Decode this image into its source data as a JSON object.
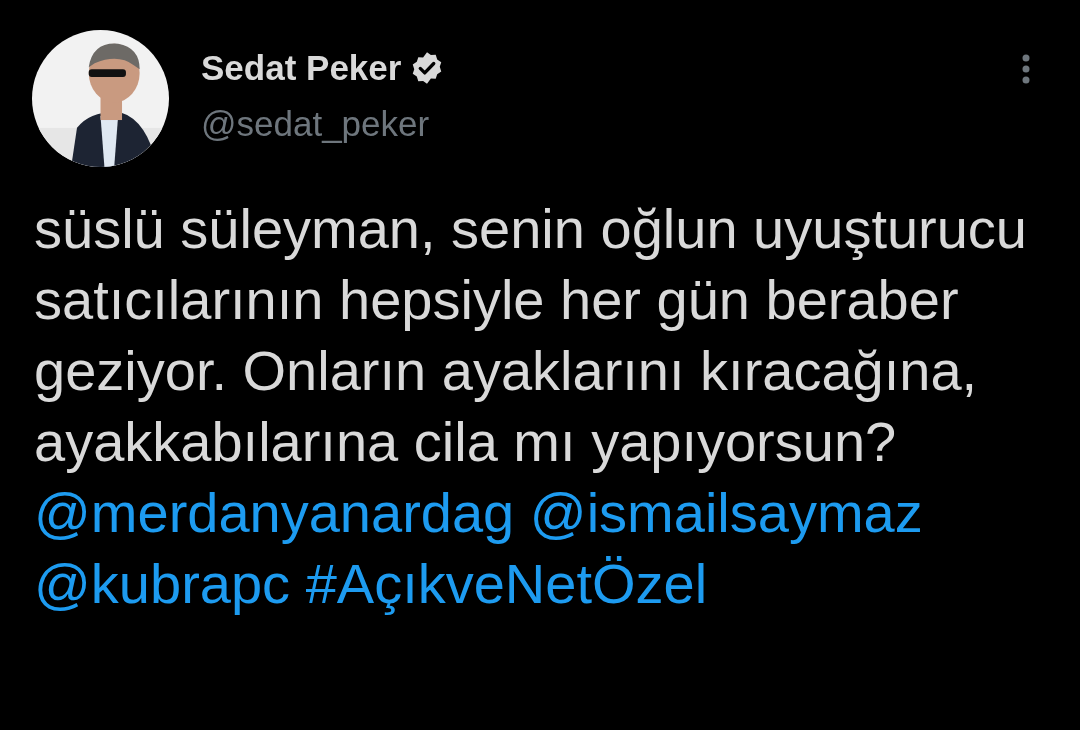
{
  "author": {
    "name": "Sedat Peker",
    "verified": true,
    "handle": "@sedat_peker"
  },
  "tweet": {
    "segments": [
      {
        "kind": "text",
        "text": "süslü süleyman, senin oğlun uyuşturucu satıcılarının hepsiyle her gün beraber geziyor. Onların ayaklarını kıracağına, ayakkabılarına cila mı yapıyorsun?"
      },
      {
        "kind": "mention",
        "text": "@merdanyanardag"
      },
      {
        "kind": "mention",
        "text": "@ismailsaymaz"
      },
      {
        "kind": "mention",
        "text": "@kubrapc"
      },
      {
        "kind": "hashtag",
        "text": "#AçıkveNetÖzel"
      }
    ]
  }
}
